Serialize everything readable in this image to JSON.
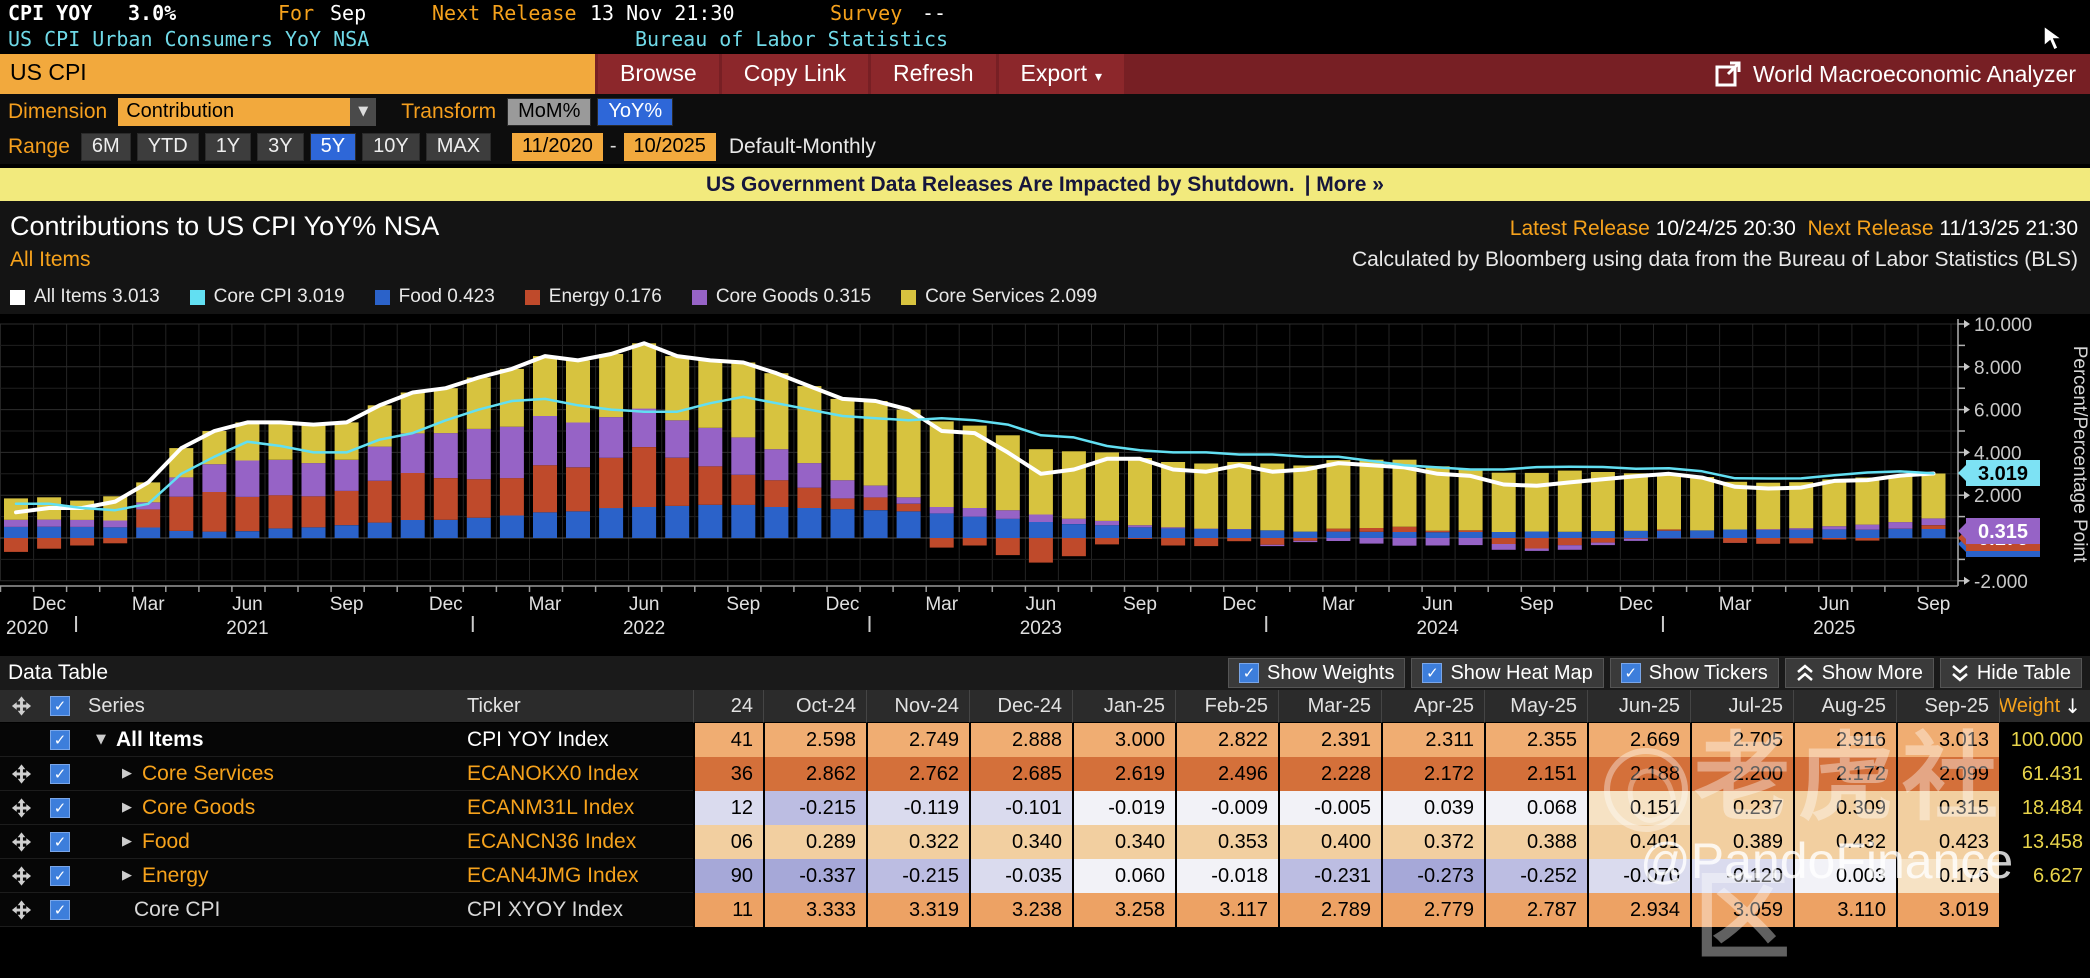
{
  "top": {
    "ticker": "CPI YOY",
    "value": "3.0%",
    "for_label": "For",
    "for_value": "Sep",
    "next_release_label": "Next Release",
    "next_release_value": "13 Nov 21:30",
    "survey_label": "Survey",
    "survey_value": "--",
    "desc_left": "US CPI Urban Consumers YoY NSA",
    "desc_right": "Bureau of Labor Statistics"
  },
  "toolbar": {
    "search_value": "US CPI",
    "buttons": [
      "Browse",
      "Copy Link",
      "Refresh"
    ],
    "export_label": "Export",
    "export_caret": "▾",
    "analyzer_label": "World Macroeconomic Analyzer"
  },
  "controls": {
    "dimension_label": "Dimension",
    "dimension_value": "Contribution",
    "dropdown_caret": "▼",
    "transform_label": "Transform",
    "transform_options": [
      {
        "label": "MoM%",
        "selected": false
      },
      {
        "label": "YoY%",
        "selected": true
      }
    ],
    "range_label": "Range",
    "range_options": [
      {
        "label": "6M",
        "selected": false
      },
      {
        "label": "YTD",
        "selected": false
      },
      {
        "label": "1Y",
        "selected": false
      },
      {
        "label": "3Y",
        "selected": false
      },
      {
        "label": "5Y",
        "selected": true
      },
      {
        "label": "10Y",
        "selected": false
      },
      {
        "label": "MAX",
        "selected": false
      }
    ],
    "date_from": "11/2020",
    "date_to": "10/2025",
    "frequency": "Default-Monthly"
  },
  "banner": {
    "text": "US Government Data Releases Are Impacted by Shutdown.",
    "more": "| More »"
  },
  "header": {
    "title": "Contributions to US CPI YoY% NSA",
    "subtitle": "All Items",
    "latest_release_label": "Latest Release",
    "latest_release": "10/24/25 20:30",
    "next_release_label": "Next Release",
    "next_release": "11/13/25 21:30",
    "source_note": "Calculated by Bloomberg using data from the Bureau of Labor Statistics (BLS)"
  },
  "legend": [
    {
      "name": "All Items",
      "value": "3.013",
      "color": "#ffffff"
    },
    {
      "name": "Core CPI",
      "value": "3.019",
      "color": "#62dff2"
    },
    {
      "name": "Food",
      "value": "0.423",
      "color": "#2b62c9"
    },
    {
      "name": "Energy",
      "value": "0.176",
      "color": "#bf4a2b"
    },
    {
      "name": "Core Goods",
      "value": "0.315",
      "color": "#9663c6"
    },
    {
      "name": "Core Services",
      "value": "2.099",
      "color": "#d7c33f"
    }
  ],
  "chart_data": {
    "type": "bar",
    "subtype": "stacked-bars-with-line-overlay",
    "title": "Contributions to US CPI YoY% NSA",
    "ylabel": "Percent/Percentage Point",
    "ylim": [
      -2,
      10
    ],
    "yticks": [
      10,
      8,
      6,
      4,
      2,
      0,
      -2
    ],
    "grid": true,
    "x": [
      "Nov-20",
      "Dec-20",
      "Jan-21",
      "Feb-21",
      "Mar-21",
      "Apr-21",
      "May-21",
      "Jun-21",
      "Jul-21",
      "Aug-21",
      "Sep-21",
      "Oct-21",
      "Nov-21",
      "Dec-21",
      "Jan-22",
      "Feb-22",
      "Mar-22",
      "Apr-22",
      "May-22",
      "Jun-22",
      "Jul-22",
      "Aug-22",
      "Sep-22",
      "Oct-22",
      "Nov-22",
      "Dec-22",
      "Jan-23",
      "Feb-23",
      "Mar-23",
      "Apr-23",
      "May-23",
      "Jun-23",
      "Jul-23",
      "Aug-23",
      "Sep-23",
      "Oct-23",
      "Nov-23",
      "Dec-23",
      "Jan-24",
      "Feb-24",
      "Mar-24",
      "Apr-24",
      "May-24",
      "Jun-24",
      "Jul-24",
      "Aug-24",
      "Sep-24",
      "Oct-24",
      "Nov-24",
      "Dec-24",
      "Jan-25",
      "Feb-25",
      "Mar-25",
      "Apr-25",
      "May-25",
      "Jun-25",
      "Jul-25",
      "Aug-25",
      "Sep-25"
    ],
    "bar_series": [
      {
        "name": "Food",
        "color": "#2b62c9",
        "values": [
          0.52,
          0.53,
          0.52,
          0.5,
          0.49,
          0.33,
          0.3,
          0.32,
          0.45,
          0.5,
          0.6,
          0.72,
          0.84,
          0.85,
          0.95,
          1.05,
          1.2,
          1.25,
          1.4,
          1.45,
          1.5,
          1.55,
          1.55,
          1.45,
          1.4,
          1.35,
          1.3,
          1.25,
          1.15,
          1.0,
          0.9,
          0.75,
          0.65,
          0.6,
          0.5,
          0.45,
          0.42,
          0.4,
          0.36,
          0.3,
          0.3,
          0.29,
          0.28,
          0.27,
          0.28,
          0.28,
          0.306,
          0.289,
          0.322,
          0.34,
          0.34,
          0.353,
          0.4,
          0.372,
          0.388,
          0.401,
          0.389,
          0.432,
          0.423
        ]
      },
      {
        "name": "Energy",
        "color": "#bf4a2b",
        "values": [
          -0.65,
          -0.5,
          -0.35,
          -0.25,
          0.85,
          1.6,
          1.85,
          1.6,
          1.55,
          1.45,
          1.6,
          1.95,
          2.2,
          1.95,
          1.8,
          1.75,
          2.2,
          2.05,
          2.35,
          2.8,
          2.25,
          1.8,
          1.4,
          1.25,
          0.95,
          0.5,
          0.6,
          0.35,
          -0.45,
          -0.35,
          -0.8,
          -1.15,
          -0.85,
          -0.3,
          -0.04,
          -0.35,
          -0.38,
          -0.15,
          -0.32,
          -0.13,
          0.14,
          0.18,
          0.25,
          0.07,
          0.08,
          -0.28,
          -0.49,
          -0.337,
          -0.215,
          -0.035,
          0.06,
          -0.018,
          -0.231,
          -0.273,
          -0.252,
          -0.07,
          -0.12,
          0.003,
          0.176
        ]
      },
      {
        "name": "Core Goods",
        "color": "#9663c6",
        "values": [
          0.33,
          0.33,
          0.33,
          0.32,
          0.33,
          0.9,
          1.3,
          1.7,
          1.65,
          1.55,
          1.45,
          1.6,
          1.85,
          2.1,
          2.35,
          2.4,
          2.3,
          2.1,
          1.9,
          1.8,
          1.75,
          1.8,
          1.75,
          1.45,
          1.15,
          0.85,
          0.55,
          0.3,
          0.3,
          0.4,
          0.4,
          0.35,
          0.25,
          0.2,
          0.1,
          0.05,
          0.02,
          0.02,
          -0.06,
          -0.06,
          -0.14,
          -0.26,
          -0.36,
          -0.35,
          -0.33,
          -0.27,
          -0.112,
          -0.215,
          -0.119,
          -0.101,
          -0.019,
          -0.009,
          -0.005,
          0.039,
          0.068,
          0.151,
          0.237,
          0.309,
          0.315
        ]
      },
      {
        "name": "Core Services",
        "color": "#d7c33f",
        "values": [
          1.0,
          1.04,
          0.9,
          1.13,
          0.93,
          1.37,
          1.55,
          1.78,
          1.75,
          1.8,
          1.75,
          1.93,
          1.91,
          2.1,
          2.4,
          2.7,
          2.8,
          2.9,
          2.95,
          3.05,
          3.0,
          3.15,
          3.5,
          3.55,
          3.6,
          3.8,
          3.95,
          4.1,
          4.0,
          3.85,
          3.5,
          3.05,
          3.15,
          3.2,
          3.14,
          3.05,
          3.04,
          3.13,
          3.12,
          3.09,
          3.2,
          3.19,
          3.13,
          3.01,
          2.87,
          2.77,
          2.736,
          2.862,
          2.762,
          2.685,
          2.619,
          2.496,
          2.228,
          2.172,
          2.151,
          2.188,
          2.2,
          2.172,
          2.099
        ]
      }
    ],
    "line_series": [
      {
        "name": "All Items",
        "color": "#ffffff",
        "values": [
          1.2,
          1.4,
          1.4,
          1.7,
          2.6,
          4.2,
          5.0,
          5.4,
          5.4,
          5.3,
          5.4,
          6.2,
          6.8,
          7.0,
          7.5,
          7.9,
          8.5,
          8.3,
          8.6,
          9.1,
          8.5,
          8.3,
          8.2,
          7.7,
          7.1,
          6.5,
          6.4,
          6.0,
          5.0,
          4.9,
          4.0,
          3.0,
          3.2,
          3.7,
          3.7,
          3.2,
          3.1,
          3.4,
          3.1,
          3.2,
          3.5,
          3.4,
          3.3,
          3.0,
          2.9,
          2.5,
          2.441,
          2.598,
          2.749,
          2.888,
          3.0,
          2.822,
          2.391,
          2.311,
          2.355,
          2.669,
          2.705,
          2.916,
          3.013
        ]
      },
      {
        "name": "Core CPI",
        "color": "#62dff2",
        "values": [
          1.6,
          1.6,
          1.4,
          1.3,
          1.6,
          3.0,
          3.8,
          4.5,
          4.3,
          4.0,
          4.0,
          4.6,
          4.9,
          5.5,
          6.0,
          6.4,
          6.5,
          6.2,
          6.0,
          5.9,
          5.9,
          6.3,
          6.6,
          6.3,
          6.0,
          5.7,
          5.6,
          5.5,
          5.6,
          5.5,
          5.3,
          4.8,
          4.7,
          4.3,
          4.1,
          4.0,
          4.0,
          3.9,
          3.9,
          3.8,
          3.8,
          3.6,
          3.4,
          3.3,
          3.2,
          3.2,
          3.311,
          3.333,
          3.319,
          3.238,
          3.258,
          3.117,
          2.789,
          2.779,
          2.787,
          2.934,
          3.059,
          3.11,
          3.019
        ]
      }
    ],
    "axis_badges": [
      {
        "value": "0.423",
        "color": "#2b62c9",
        "text_color": "#ffffff",
        "center": 230
      },
      {
        "value": "0.176",
        "color": "#bf4a2b",
        "text_color": "#ffffff",
        "center": 224
      },
      {
        "value": "0.315",
        "color": "#9663c6",
        "text_color": "#ffffff",
        "center": 217
      },
      {
        "value": "3.019",
        "color": "#7de2f4",
        "text_color": "#000000",
        "center": 159
      }
    ],
    "x_axis_years": [
      {
        "label": "2020",
        "month_index": 1,
        "align": "left"
      },
      {
        "label": "2021",
        "month_index": 7
      },
      {
        "label": "2022",
        "month_index": 19
      },
      {
        "label": "2023",
        "month_index": 31
      },
      {
        "label": "2024",
        "month_index": 43
      },
      {
        "label": "2025",
        "month_index": 55
      }
    ]
  },
  "table": {
    "bar_title": "Data Table",
    "toggles": [
      {
        "label": "Show Weights",
        "checked": true
      },
      {
        "label": "Show Heat Map",
        "checked": true
      },
      {
        "label": "Show Tickers",
        "checked": true
      }
    ],
    "show_more_label": "Show More",
    "hide_table_label": "Hide Table",
    "check_glyph": "✓",
    "sort_arrow": "↓",
    "series_header": "Series",
    "ticker_header": "Ticker",
    "partial_header": "24",
    "months": [
      "Oct-24",
      "Nov-24",
      "Dec-24",
      "Jan-25",
      "Feb-25",
      "Mar-25",
      "Apr-25",
      "May-25",
      "Jun-25",
      "Jul-25",
      "Aug-25",
      "Sep-25"
    ],
    "weight_header": "Weight",
    "rows": [
      {
        "series": "All Items",
        "arrow": "▼",
        "indent": 18,
        "movable": false,
        "series_color": "#ffffff",
        "ticker": "CPI YOY Index",
        "ticker_color": "#ffffff",
        "partial": {
          "text": "41",
          "value": 2.441
        },
        "pos_color": "#f0ad72",
        "values": [
          "2.598",
          "2.749",
          "2.888",
          "3.000",
          "2.822",
          "2.391",
          "2.311",
          "2.355",
          "2.669",
          "2.705",
          "2.916",
          "3.013"
        ],
        "weight": "100.000"
      },
      {
        "series": "Core Services",
        "arrow": "▶",
        "indent": 44,
        "movable": true,
        "series_color": "#f6a21c",
        "ticker": "ECANOKX0 Index",
        "ticker_color": "#f6a21c",
        "partial": {
          "text": "36",
          "value": 2.736
        },
        "pos_color": "#d4703a",
        "values": [
          "2.862",
          "2.762",
          "2.685",
          "2.619",
          "2.496",
          "2.228",
          "2.172",
          "2.151",
          "2.188",
          "2.200",
          "2.172",
          "2.099"
        ],
        "weight": "61.431"
      },
      {
        "series": "Core Goods",
        "arrow": "▶",
        "indent": 44,
        "movable": true,
        "series_color": "#f6a21c",
        "ticker": "ECANM31L Index",
        "ticker_color": "#f6a21c",
        "partial": {
          "text": "12",
          "value": -0.112
        },
        "pos_color": "#f2cfa0",
        "values": [
          "-0.215",
          "-0.119",
          "-0.101",
          "-0.019",
          "-0.009",
          "-0.005",
          "0.039",
          "0.068",
          "0.151",
          "0.237",
          "0.309",
          "0.315"
        ],
        "weight": "18.484"
      },
      {
        "series": "Food",
        "arrow": "▶",
        "indent": 44,
        "movable": true,
        "series_color": "#f6a21c",
        "ticker": "ECANCN36 Index",
        "ticker_color": "#f6a21c",
        "partial": {
          "text": "06",
          "value": 0.306
        },
        "pos_color": "#f2cfa0",
        "values": [
          "0.289",
          "0.322",
          "0.340",
          "0.340",
          "0.353",
          "0.400",
          "0.372",
          "0.388",
          "0.401",
          "0.389",
          "0.432",
          "0.423"
        ],
        "weight": "13.458"
      },
      {
        "series": "Energy",
        "arrow": "▶",
        "indent": 44,
        "movable": true,
        "series_color": "#f6a21c",
        "ticker": "ECAN4JMG Index",
        "ticker_color": "#f6a21c",
        "partial": {
          "text": "90",
          "value": -0.49
        },
        "pos_color": "#f6e2c4",
        "values": [
          "-0.337",
          "-0.215",
          "-0.035",
          "0.060",
          "-0.018",
          "-0.231",
          "-0.273",
          "-0.252",
          "-0.070",
          "-0.120",
          "0.003",
          "0.176"
        ],
        "weight": "6.627"
      },
      {
        "series": "Core CPI",
        "arrow": "",
        "indent": 56,
        "movable": true,
        "series_color": "#d8d8d8",
        "ticker": "CPI XYOY Index",
        "ticker_color": "#d8d8d8",
        "partial": {
          "text": "11",
          "value": 3.311
        },
        "pos_color": "#eda264",
        "values": [
          "3.333",
          "3.319",
          "3.238",
          "3.258",
          "3.117",
          "2.789",
          "2.779",
          "2.787",
          "2.934",
          "3.059",
          "3.110",
          "3.019"
        ],
        "weight": ""
      }
    ]
  },
  "watermark": {
    "community": "老虎社区",
    "handle": "@PandoFinance"
  }
}
